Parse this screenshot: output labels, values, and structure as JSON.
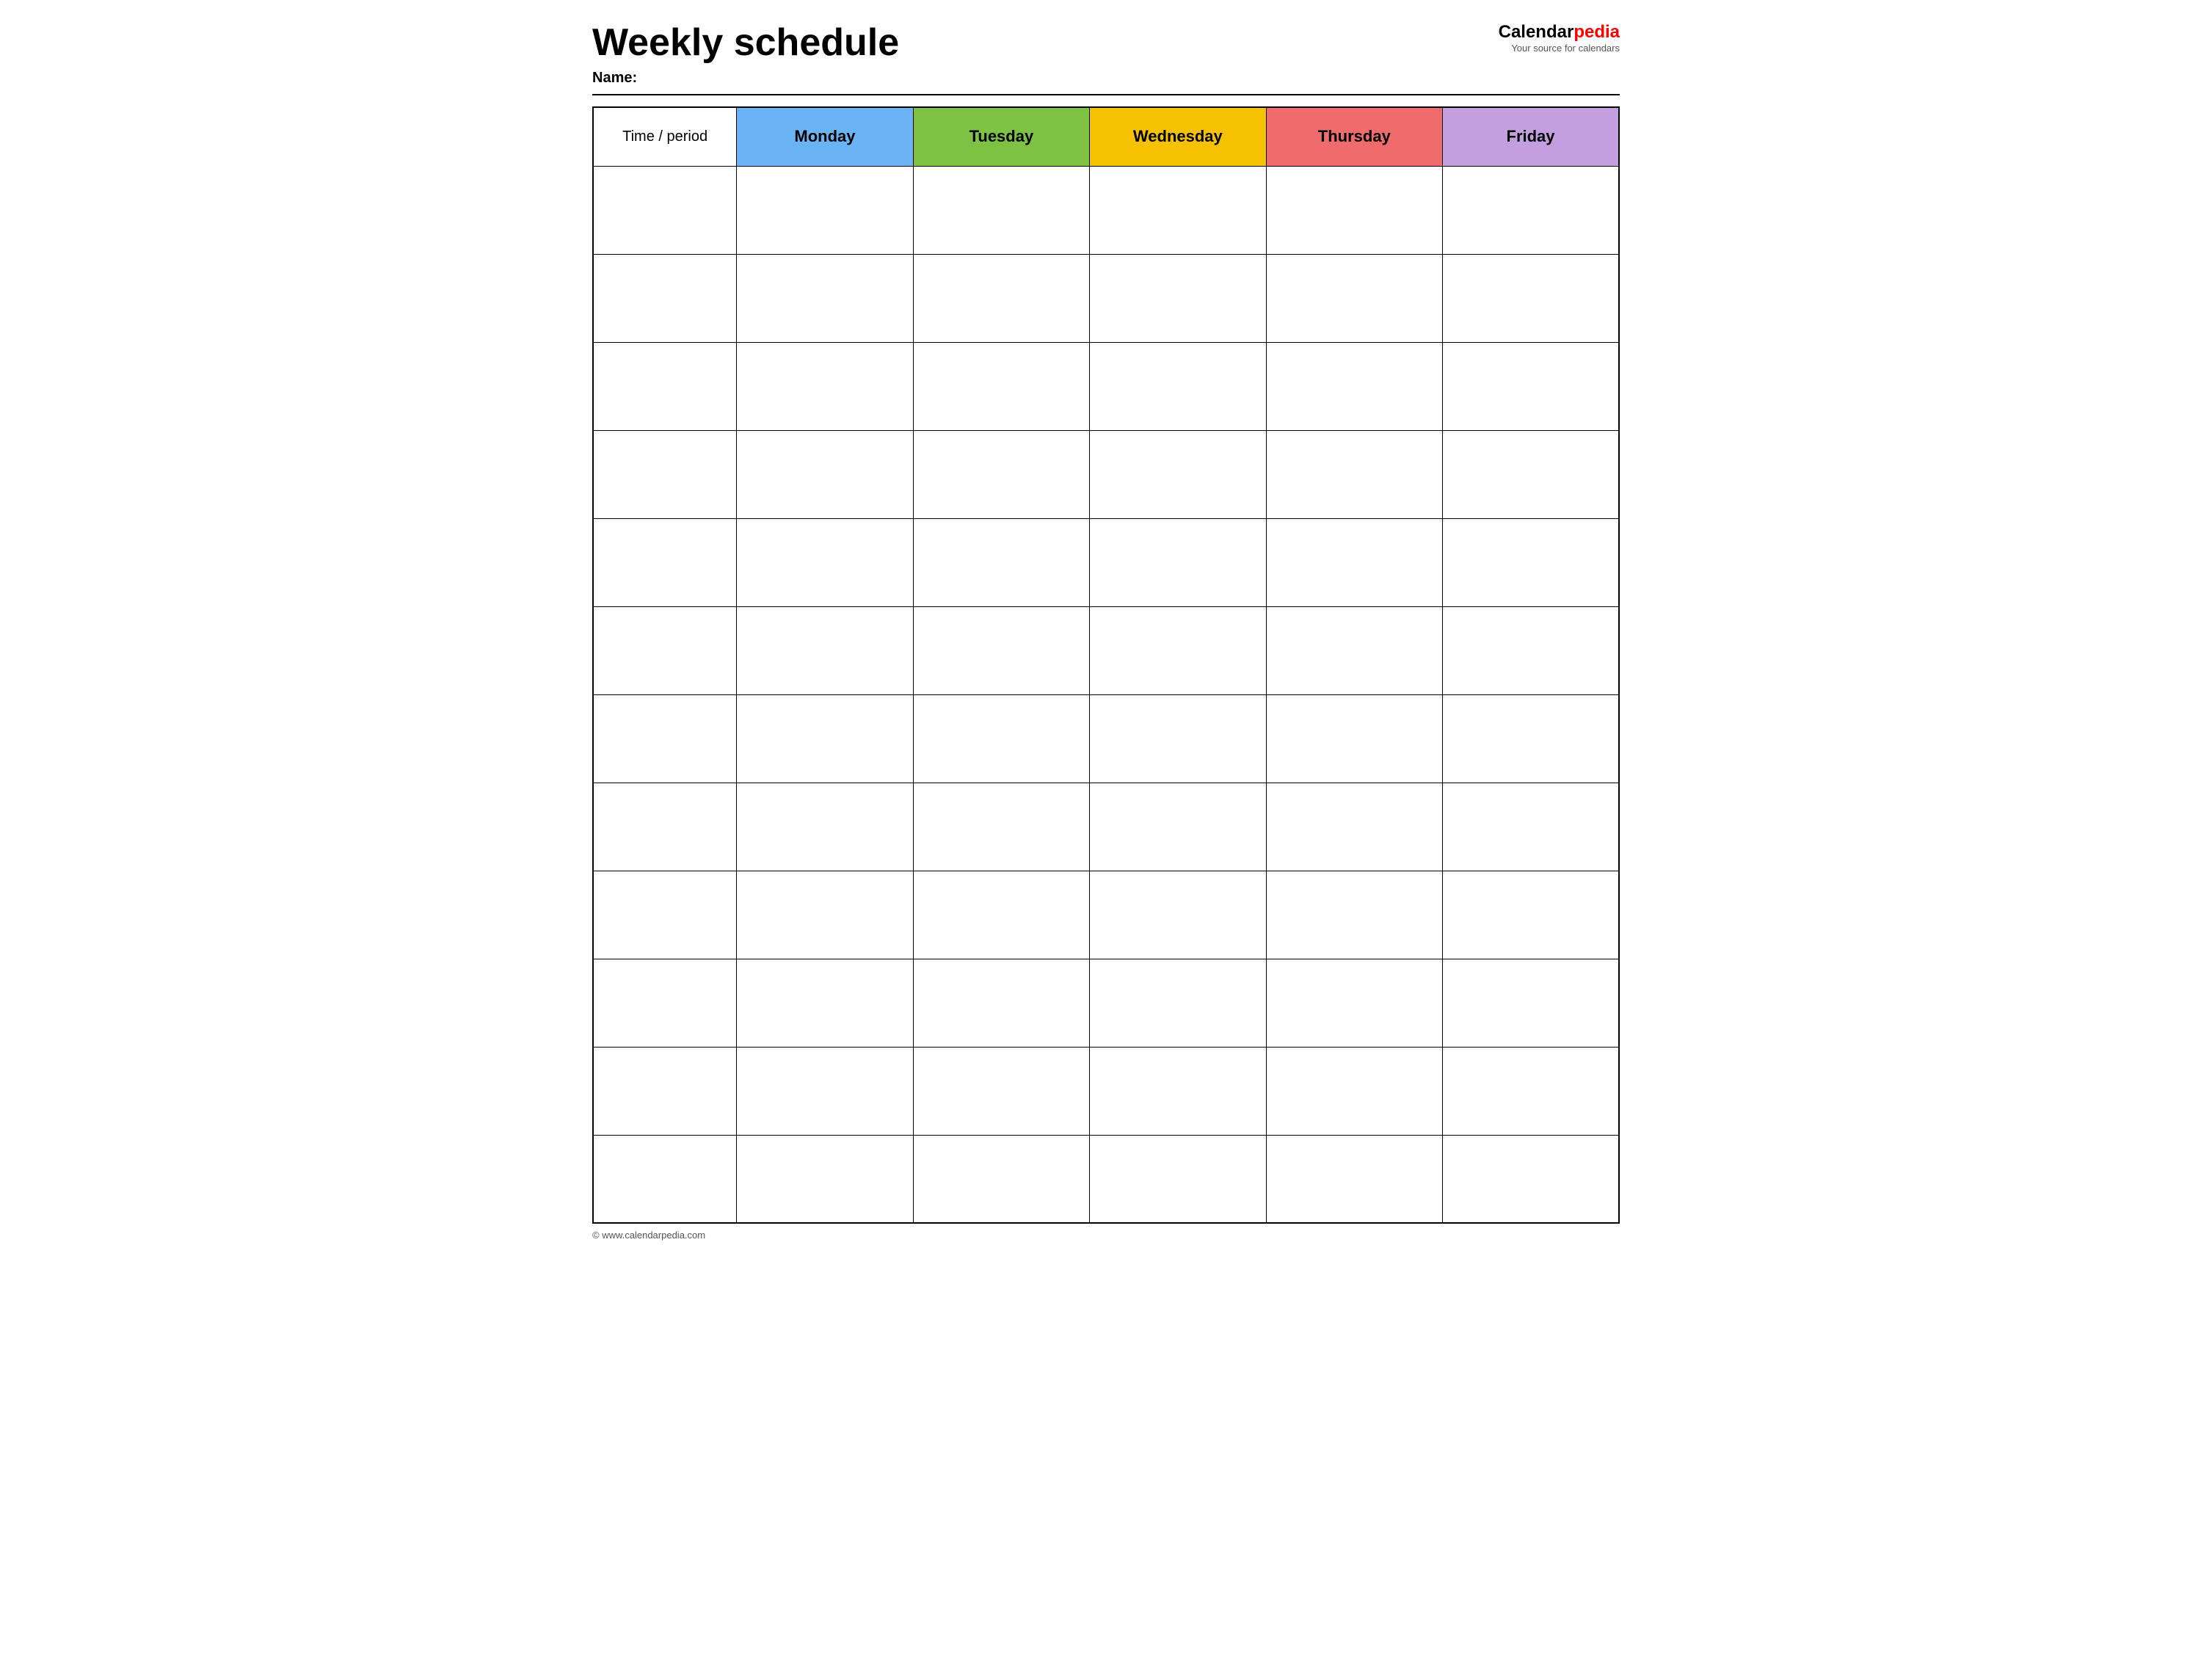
{
  "header": {
    "title": "Weekly schedule",
    "name_label": "Name:",
    "logo": {
      "calendar_text": "Calendar",
      "pedia_text": "pedia",
      "tagline": "Your source for calendars"
    }
  },
  "table": {
    "columns": [
      {
        "label": "Time / period",
        "class": "th-time"
      },
      {
        "label": "Monday",
        "class": "th-monday"
      },
      {
        "label": "Tuesday",
        "class": "th-tuesday"
      },
      {
        "label": "Wednesday",
        "class": "th-wednesday"
      },
      {
        "label": "Thursday",
        "class": "th-thursday"
      },
      {
        "label": "Friday",
        "class": "th-friday"
      }
    ],
    "row_count": 12
  },
  "footer": {
    "url": "© www.calendarpedia.com"
  }
}
